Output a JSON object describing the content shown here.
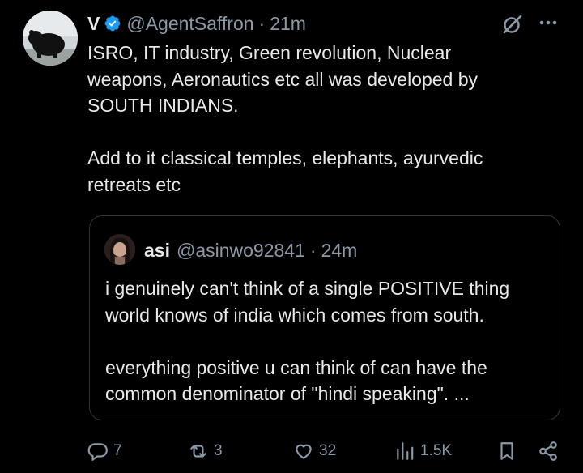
{
  "author": {
    "display_name": "V",
    "handle": "@AgentSaffron",
    "separator": "·",
    "time": "21m"
  },
  "tweet_text": "ISRO, IT industry, Green revolution, Nuclear\nweapons, Aeronautics etc all was developed by\nSOUTH INDIANS.\n\nAdd to it classical temples, elephants, ayurvedic\nretreats etc",
  "quoted": {
    "display_name": "asi",
    "handle": "@asinwo92841",
    "separator": "·",
    "time": "24m",
    "text": "i genuinely can't think of a single POSITIVE thing\nworld knows of india which comes from south.\n\neverything positive u can think of can have the\ncommon denominator of \"hindi speaking\". ..."
  },
  "actions": {
    "replies": "7",
    "reposts": "3",
    "likes": "32",
    "views": "1.5K"
  },
  "colors": {
    "background": "#000000",
    "text": "#e7e9ea",
    "muted": "#8b98a5",
    "verified": "#1d9bf0",
    "border": "#2f3336"
  },
  "icons": [
    "verified-badge-icon",
    "grok-icon",
    "more-icon",
    "reply-icon",
    "repost-icon",
    "like-icon",
    "views-icon",
    "bookmark-icon",
    "share-icon"
  ]
}
